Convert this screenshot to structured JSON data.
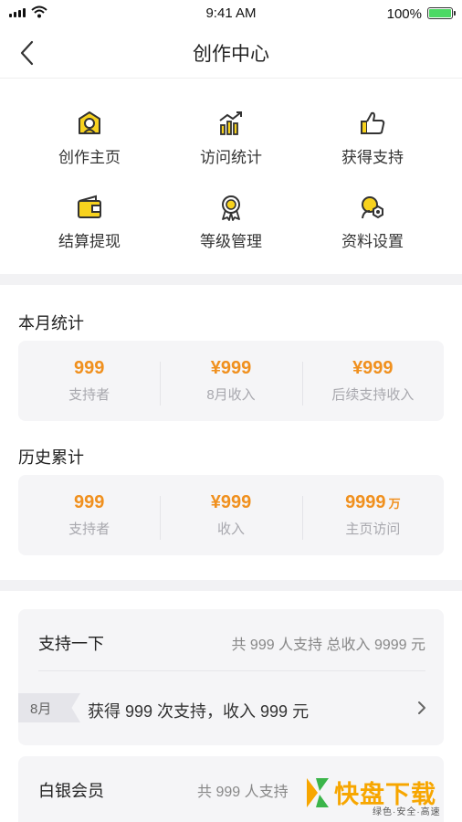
{
  "status_bar": {
    "time": "9:41 AM",
    "battery_percent": "100%",
    "battery_level": 1.0,
    "icons": [
      "signal-icon",
      "wifi-icon",
      "battery-icon"
    ]
  },
  "nav": {
    "title": "创作中心",
    "back_icon": "back-chevron-icon"
  },
  "features": [
    {
      "label": "创作主页",
      "icon": "creator-home-icon"
    },
    {
      "label": "访问统计",
      "icon": "visit-stats-icon"
    },
    {
      "label": "获得支持",
      "icon": "thumbs-up-icon"
    },
    {
      "label": "结算提现",
      "icon": "wallet-icon"
    },
    {
      "label": "等级管理",
      "icon": "medal-icon"
    },
    {
      "label": "资料设置",
      "icon": "settings-icon"
    }
  ],
  "monthly": {
    "title": "本月统计",
    "stats": [
      {
        "value": "999",
        "label": "支持者"
      },
      {
        "value": "¥999",
        "label": "8月收入"
      },
      {
        "value": "¥999",
        "label": "后续支持收入"
      }
    ]
  },
  "history": {
    "title": "历史累计",
    "stats": [
      {
        "value": "999",
        "label": "支持者"
      },
      {
        "value": "¥999",
        "label": "收入"
      },
      {
        "value": "9999",
        "unit": "万",
        "label": "主页访问"
      }
    ]
  },
  "support_card": {
    "title": "支持一下",
    "meta": "共 999 人支持  总收入 9999 元",
    "month_tag": "8月",
    "record": "获得 999 次支持，收入 999 元"
  },
  "silver_card": {
    "title": "白银会员",
    "meta": "共 999 人支持"
  },
  "watermark": {
    "big_text": "快盘下载",
    "small_text": "绿色·安全·高速"
  },
  "colors": {
    "accent_orange": "#f0901e",
    "icon_yellow": "#f7d21e",
    "battery_green": "#4cd964",
    "card_bg": "#f5f5f7",
    "divider_bg": "#f2f2f4"
  }
}
